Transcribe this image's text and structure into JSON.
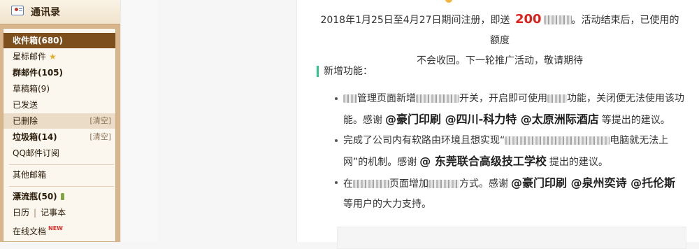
{
  "sidebar": {
    "contacts_label": "通讯录",
    "folders": [
      {
        "label": "收件箱(680)",
        "selected": true
      },
      {
        "label": "星标邮件",
        "icon": "star-icon"
      },
      {
        "label": "群邮件(105)",
        "bold": true
      },
      {
        "label": "草稿箱(9)"
      },
      {
        "label": "已发送"
      },
      {
        "label": "已删除",
        "action": "[清空]",
        "highlight": true
      },
      {
        "label": "垃圾箱(14)",
        "action": "[清空]",
        "bold": true
      },
      {
        "label": "QQ邮件订阅"
      },
      {
        "label": "其他邮箱"
      },
      {
        "label": "漂流瓶(50)",
        "icon": "bottle-icon",
        "bold": true
      },
      {
        "label": "日历"
      },
      {
        "label": "记事本"
      },
      {
        "label": "在线文档",
        "badge": "NEW"
      }
    ]
  },
  "content": {
    "intro_line1_a": "2018年1月25日至4月27日期间注册，即送",
    "intro_number": "200",
    "intro_line1_b": "。活动结束后，已使用的额度",
    "intro_line2": "不会收回。下一轮推广活动，敬请期待",
    "section_title": "新增功能：",
    "features": [
      {
        "p1": "管理页面新增",
        "p2": "开关，开启即可使用",
        "p3": "功能，关闭便无法使用该功能。感谢",
        "thanks": "@豪门印刷 @四川-科力特 @太原洲际酒店",
        "p4": "等提出的建议。"
      },
      {
        "p1": "完成了公司内有软路由环境且想实现“",
        "p2": "电脑就无法上网”的机制。感谢",
        "thanks": "@ 东莞联合高级技工学校",
        "p3": "提出的建议。"
      },
      {
        "p0": "在",
        "p1": "页面增加",
        "p2": "方式。感谢",
        "thanks": "@豪门印刷 @泉州奕诗 @托伦斯",
        "p3": "等用户的大力支持。"
      }
    ]
  },
  "colors": {
    "sidebar_bg": "#d9b58c",
    "selected_bg": "#7d4f1d",
    "accent_red": "#e0211b",
    "section_bar": "#2fc58b"
  }
}
